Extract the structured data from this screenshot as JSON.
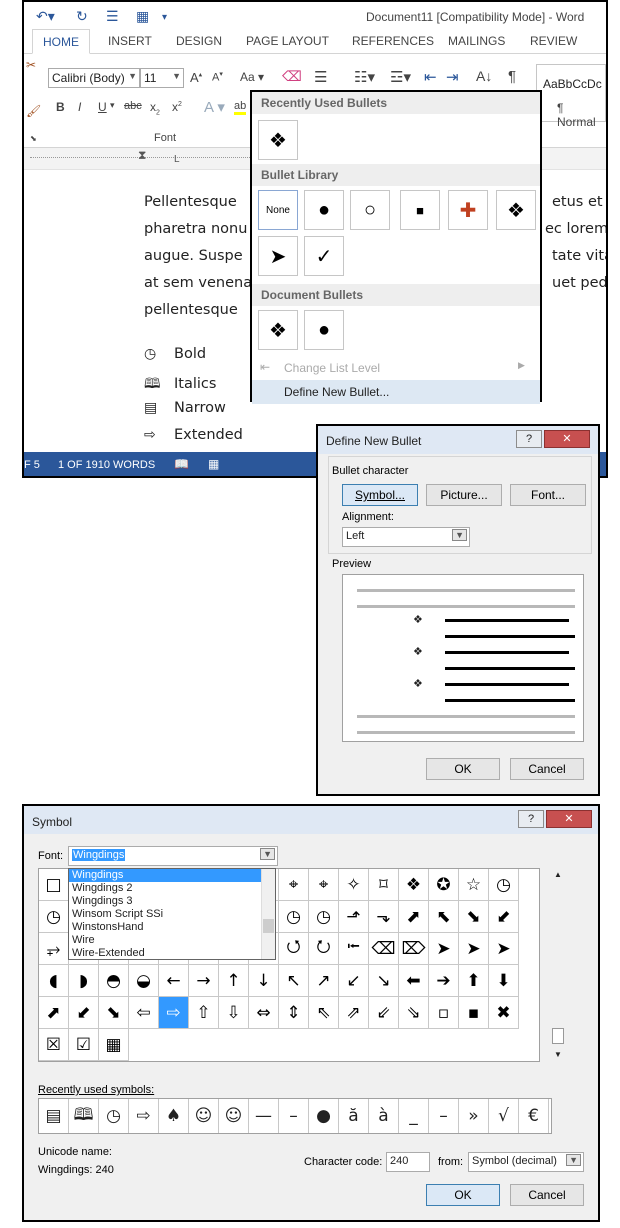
{
  "word": {
    "title": "Document11 [Compatibility Mode] - Word",
    "tabs": [
      "HOME",
      "INSERT",
      "DESIGN",
      "PAGE LAYOUT",
      "REFERENCES",
      "MAILINGS",
      "REVIEW"
    ],
    "font_name": "Calibri (Body)",
    "font_size": "11",
    "font_group_label": "Font",
    "style_preview": "AaBbCcDc",
    "style_name": "¶ Normal",
    "paragraph_lines": [
      "Pellentesque",
      "pharetra nonu",
      "augue. Suspe",
      "at sem venena",
      "pellentesque"
    ],
    "paragraph_lines_right": [
      "etus et",
      "ec lorem",
      "tate vita",
      "uet ped",
      ""
    ],
    "list_items": [
      {
        "icon": "◷",
        "label": "Bold"
      },
      {
        "icon": "🕮",
        "label": "Italics"
      },
      {
        "icon": "▤",
        "label": "Narrow"
      },
      {
        "icon": "⇨",
        "label": "Extended"
      }
    ],
    "status": {
      "page": "F 5",
      "words": "1 OF 1910 WORDS"
    }
  },
  "bullet_menu": {
    "recent_header": "Recently Used Bullets",
    "library_header": "Bullet Library",
    "document_header": "Document Bullets",
    "none_label": "None",
    "change_level": "Change List Level",
    "define_new": "Define New Bullet..."
  },
  "define_dialog": {
    "title": "Define New Bullet",
    "bullet_character_label": "Bullet character",
    "symbol_btn": "Symbol...",
    "picture_btn": "Picture...",
    "font_btn": "Font...",
    "alignment_label": "Alignment:",
    "alignment_value": "Left",
    "preview_label": "Preview",
    "ok": "OK",
    "cancel": "Cancel"
  },
  "symbol_dialog": {
    "title": "Symbol",
    "font_label": "Font:",
    "font_value": "Wingdings",
    "font_options": [
      "Wingdings",
      "Wingdings 2",
      "Wingdings 3",
      "Winsom Script SSi",
      "WinstonsHand",
      "Wire",
      "Wire-Extended"
    ],
    "grid_rows": [
      [
        "□",
        "",
        "",
        "",
        "",
        "",
        "",
        "",
        "⌖",
        "⌖",
        "✧",
        "⌑",
        "❖",
        "✪",
        "☆",
        "◷",
        "◷"
      ],
      [
        "◷",
        "",
        "",
        "",
        "",
        "",
        "",
        "",
        "◷",
        "◷",
        "⬏",
        "⬎",
        "⬈",
        "⬉",
        "⬊",
        "⬋"
      ],
      [
        "⥅",
        "",
        "",
        "",
        "",
        "",
        "",
        "",
        "⭯",
        "⭮",
        "⭰",
        "⌫",
        "⌦",
        "➤",
        "➤",
        "➤",
        "➤"
      ],
      [
        "◖",
        "◗",
        "◓",
        "◒",
        "←",
        "→",
        "↑",
        "↓",
        "↖",
        "↗",
        "↙",
        "↘",
        "⬅",
        "➔",
        "⬆",
        "⬇",
        "⬉"
      ],
      [
        "⬈",
        "⬋",
        "⬊",
        "⇦",
        "⇨",
        "⇧",
        "⇩",
        "⇔",
        "⇕",
        "⇖",
        "⇗",
        "⇙",
        "⇘",
        "▫",
        "▪",
        "✖",
        "✔"
      ],
      [
        "☒",
        "☑",
        "▦"
      ]
    ],
    "recent_label": "Recently used symbols:",
    "recent_symbols": [
      "▤",
      "🕮",
      "◷",
      "⇨",
      "♠",
      "☺",
      "☺",
      "—",
      "–",
      "●",
      "ă",
      "à",
      "_",
      "–",
      "»",
      "√",
      "€"
    ],
    "unicode_name_label": "Unicode name:",
    "unicode_name_value": "Wingdings: 240",
    "char_code_label": "Character code:",
    "char_code_value": "240",
    "from_label": "from:",
    "from_value": "Symbol (decimal)",
    "ok": "OK",
    "cancel": "Cancel"
  },
  "colors": {
    "accent": "#2b579a",
    "selection": "#3399ff"
  }
}
